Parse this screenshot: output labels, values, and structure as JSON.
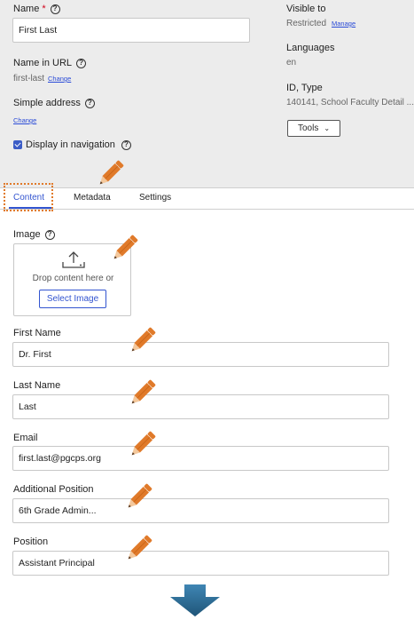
{
  "properties": {
    "name": {
      "label": "Name",
      "required": "*",
      "value": "First Last"
    },
    "name_in_url": {
      "label": "Name in URL",
      "value": "first-last",
      "change_link": "Change"
    },
    "simple_address": {
      "label": "Simple address",
      "change_link": "Change"
    },
    "display_in_nav": {
      "label": "Display in navigation",
      "checked": true
    },
    "visible_to": {
      "label": "Visible to",
      "value": "Restricted",
      "manage_link": "Manage"
    },
    "languages": {
      "label": "Languages",
      "value": "en"
    },
    "id_type": {
      "label": "ID, Type",
      "value": "140141, School Faculty Detail ..."
    },
    "tools": {
      "label": "Tools"
    }
  },
  "tabs": [
    {
      "label": "Content",
      "active": true
    },
    {
      "label": "Metadata",
      "active": false
    },
    {
      "label": "Settings",
      "active": false
    }
  ],
  "content": {
    "image": {
      "label": "Image",
      "drop_text": "Drop content here or",
      "select_button": "Select Image"
    },
    "first_name": {
      "label": "First Name",
      "value": "Dr. First"
    },
    "last_name": {
      "label": "Last Name",
      "value": "Last"
    },
    "email": {
      "label": "Email",
      "value": "first.last@pgcps.org"
    },
    "additional_position": {
      "label": "Additional Position",
      "value": "6th Grade Admin..."
    },
    "position": {
      "label": "Position",
      "value": "Assistant Principal"
    }
  },
  "annotation": {
    "pencil_color": "#e07a2a",
    "arrow_color": "#2e6a91",
    "focus_color": "#e07a2a"
  }
}
